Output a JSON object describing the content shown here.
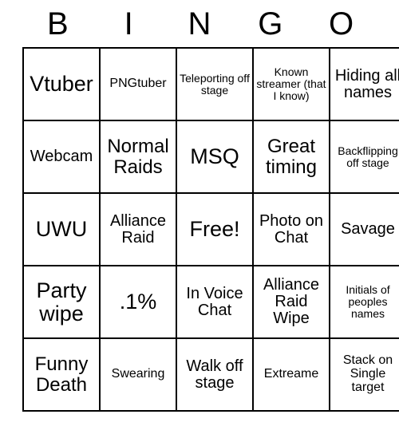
{
  "header": {
    "letters": [
      "B",
      "I",
      "N",
      "G",
      "O"
    ]
  },
  "grid": {
    "rows": [
      [
        {
          "text": "Vtuber",
          "size": "fs-xl"
        },
        {
          "text": "PNGtuber",
          "size": "fs-s"
        },
        {
          "text": "Teleporting off stage",
          "size": "fs-xs"
        },
        {
          "text": "Known streamer (that I know)",
          "size": "fs-xs"
        },
        {
          "text": "Hiding all names",
          "size": "fs-m"
        }
      ],
      [
        {
          "text": "Webcam",
          "size": "fs-m"
        },
        {
          "text": "Normal Raids",
          "size": "fs-l"
        },
        {
          "text": "MSQ",
          "size": "fs-xl"
        },
        {
          "text": "Great timing",
          "size": "fs-l"
        },
        {
          "text": "Backflipping off stage",
          "size": "fs-xs"
        }
      ],
      [
        {
          "text": "UWU",
          "size": "fs-xl"
        },
        {
          "text": "Alliance Raid",
          "size": "fs-m"
        },
        {
          "text": "Free!",
          "size": "fs-xl"
        },
        {
          "text": "Photo on Chat",
          "size": "fs-m"
        },
        {
          "text": "Savage",
          "size": "fs-m"
        }
      ],
      [
        {
          "text": "Party wipe",
          "size": "fs-xl"
        },
        {
          "text": ".1%",
          "size": "fs-xl"
        },
        {
          "text": "In Voice Chat",
          "size": "fs-m"
        },
        {
          "text": "Alliance Raid Wipe",
          "size": "fs-m"
        },
        {
          "text": "Initials of peoples names",
          "size": "fs-xs"
        }
      ],
      [
        {
          "text": "Funny Death",
          "size": "fs-l"
        },
        {
          "text": "Swearing",
          "size": "fs-s"
        },
        {
          "text": "Walk off stage",
          "size": "fs-m"
        },
        {
          "text": "Extreame",
          "size": "fs-s"
        },
        {
          "text": "Stack on Single target",
          "size": "fs-s"
        }
      ]
    ]
  }
}
